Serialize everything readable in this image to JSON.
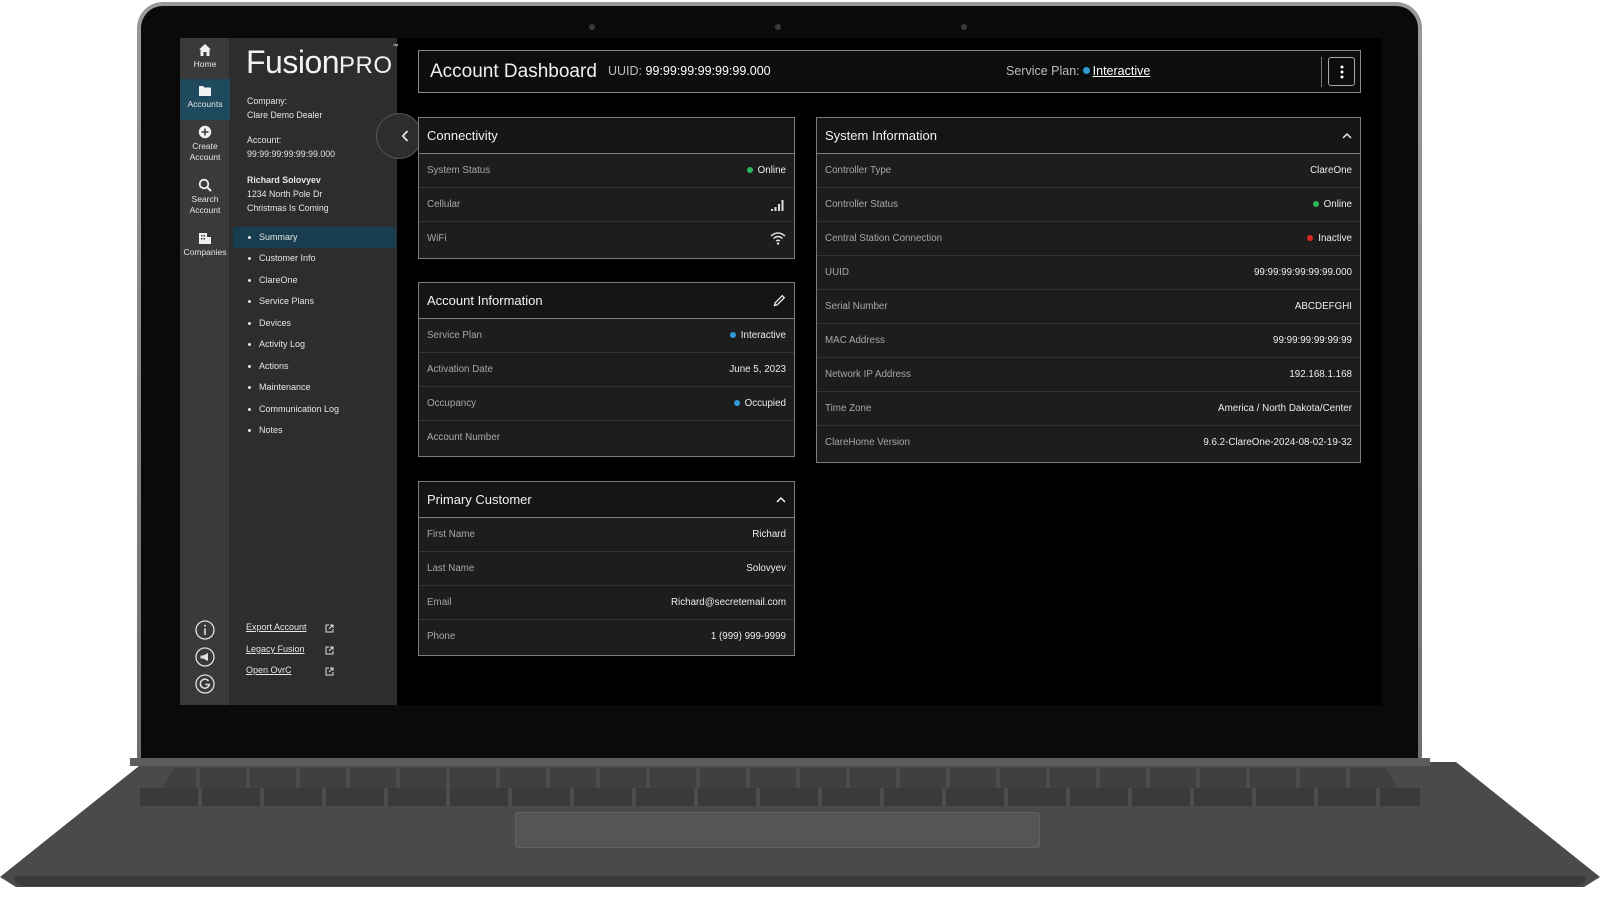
{
  "app": {
    "logo_main": "Fusion",
    "logo_pro": "PRO",
    "logo_tm": "™"
  },
  "rail": {
    "items": [
      {
        "label": "Home",
        "icon": "home-icon"
      },
      {
        "label": "Accounts",
        "icon": "folder-icon",
        "active": true
      },
      {
        "label_line1": "Create",
        "label_line2": "Account",
        "icon": "plus-circle-icon"
      },
      {
        "label_line1": "Search",
        "label_line2": "Account",
        "icon": "search-icon"
      },
      {
        "label": "Companies",
        "icon": "companies-icon"
      }
    ],
    "bottom_icons": [
      "info-icon",
      "megaphone-icon",
      "g-logo-icon"
    ]
  },
  "panel": {
    "company_label": "Company:",
    "company_value": "Clare Demo Dealer",
    "account_label": "Account:",
    "account_value": "99:99:99:99:99:99.000",
    "customer_name": "Richard Solovyev",
    "address_line1": "1234 North Pole Dr",
    "address_line2": "Christmas Is Coming",
    "nav": [
      "Summary",
      "Customer Info",
      "ClareOne",
      "Service Plans",
      "Devices",
      "Activity Log",
      "Actions",
      "Maintenance",
      "Communication Log",
      "Notes"
    ],
    "nav_active": "Summary",
    "links": [
      "Export Account",
      "Legacy Fusion",
      "Open OvrC"
    ]
  },
  "header": {
    "title": "Account Dashboard",
    "uuid_label": "UUID:",
    "uuid_value": "99:99:99:99:99:99.000",
    "plan_label": "Service Plan:",
    "plan_value": "Interactive"
  },
  "connectivity": {
    "title": "Connectivity",
    "rows": [
      {
        "label": "System Status",
        "value": "Online",
        "status_color": "#2eb85c"
      },
      {
        "label": "Cellular",
        "icon": "signal-bars-icon"
      },
      {
        "label": "WiFi",
        "icon": "wifi-icon"
      }
    ]
  },
  "account_info": {
    "title": "Account Information",
    "rows": [
      {
        "label": "Service Plan",
        "value": "Interactive",
        "status_color": "#2f9bd6"
      },
      {
        "label": "Activation Date",
        "value": "June 5, 2023"
      },
      {
        "label": "Occupancy",
        "value": "Occupied",
        "status_color": "#2f9bd6"
      },
      {
        "label": "Account Number",
        "value": ""
      }
    ]
  },
  "primary_customer": {
    "title": "Primary Customer",
    "rows": [
      {
        "label": "First Name",
        "value": "Richard"
      },
      {
        "label": "Last Name",
        "value": "Solovyev"
      },
      {
        "label": "Email",
        "value": "Richard@secretemail.com"
      },
      {
        "label": "Phone",
        "value": "1 (999) 999-9999"
      }
    ]
  },
  "system_info": {
    "title": "System Information",
    "rows": [
      {
        "label": "Controller Type",
        "value": "ClareOne"
      },
      {
        "label": "Controller Status",
        "value": "Online",
        "status_color": "#2eb85c"
      },
      {
        "label": "Central Station Connection",
        "value": "Inactive",
        "status_color": "#e02424"
      },
      {
        "label": "UUID",
        "value": "99:99:99:99:99:99.000"
      },
      {
        "label": "Serial Number",
        "value": "ABCDEFGHI"
      },
      {
        "label": "MAC Address",
        "value": "99:99:99:99:99:99"
      },
      {
        "label": "Network IP Address",
        "value": "192.168.1.168"
      },
      {
        "label": "Time Zone",
        "value": "America / North Dakota/Center"
      },
      {
        "label": "ClareHome Version",
        "value": "9.6.2-ClareOne-2024-08-02-19-32"
      }
    ]
  },
  "colors": {
    "accent": "#173d4f",
    "online": "#2eb85c",
    "inactive": "#e02424",
    "info": "#2f9bd6"
  }
}
